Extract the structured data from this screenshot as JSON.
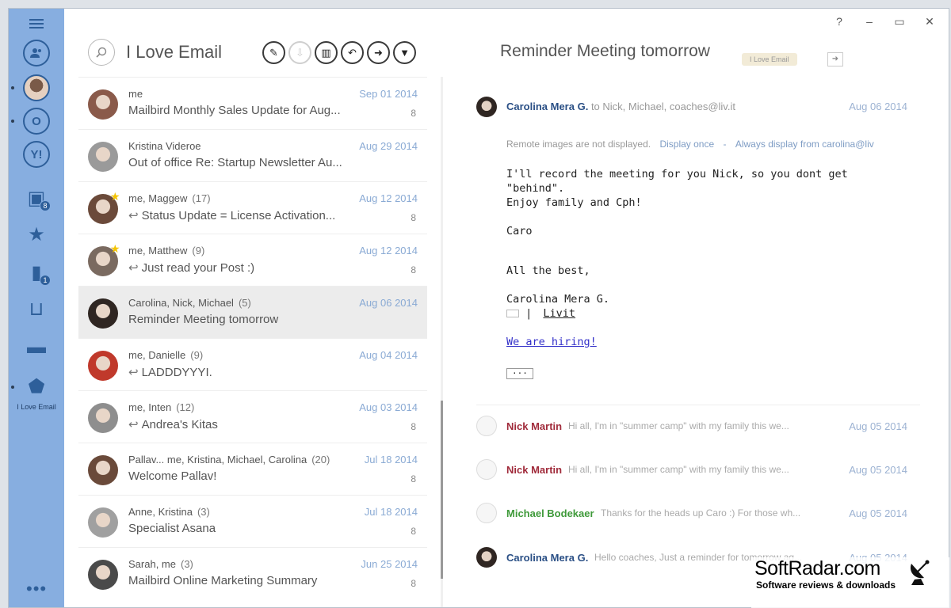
{
  "window": {
    "help": "?",
    "minimize": "–",
    "maximize": "▭",
    "close": "✕"
  },
  "sidebar": {
    "account_label": "I Love Email",
    "more": "•••"
  },
  "list": {
    "title": "I Love Email",
    "messages": [
      {
        "from": "me",
        "count": "",
        "date": "Sep 01 2014",
        "subject": "Mailbird Monthly Sales Update for Aug...",
        "num": "8",
        "reply": false,
        "star": false,
        "avatar_color": "#8a5a4a"
      },
      {
        "from": "Kristina Videroe",
        "count": "",
        "date": "Aug 29 2014",
        "subject": "Out of office Re: Startup Newsletter Au...",
        "num": "",
        "reply": false,
        "star": false,
        "avatar_color": "#9a9a9a"
      },
      {
        "from": "me, Maggew",
        "count": "(17)",
        "date": "Aug 12 2014",
        "subject": "Status Update = License Activation...",
        "num": "8",
        "reply": true,
        "star": true,
        "avatar_color": "#6b4a3a"
      },
      {
        "from": "me, Matthew",
        "count": "(9)",
        "date": "Aug 12 2014",
        "subject": "Just read your Post :)",
        "num": "8",
        "reply": true,
        "star": true,
        "avatar_color": "#7a6a60"
      },
      {
        "from": "Carolina, Nick, Michael",
        "count": "(5)",
        "date": "Aug 06 2014",
        "subject": "Reminder Meeting tomorrow",
        "num": "",
        "reply": false,
        "star": false,
        "avatar_color": "#2f2622",
        "selected": true
      },
      {
        "from": "me, Danielle",
        "count": "(9)",
        "date": "Aug 04 2014",
        "subject": "LADDDYYYI.",
        "num": "",
        "reply": true,
        "star": false,
        "avatar_color": "#c0392b"
      },
      {
        "from": "me, Inten",
        "count": "(12)",
        "date": "Aug 03 2014",
        "subject": "Andrea's Kitas",
        "num": "8",
        "reply": true,
        "star": false,
        "avatar_color": "#8e8e8e"
      },
      {
        "from": "Pallav... me, Kristina, Michael, Carolina",
        "count": "(20)",
        "date": "Jul 18 2014",
        "subject": "Welcome Pallav!",
        "num": "8",
        "reply": false,
        "star": false,
        "avatar_color": "#6a4a3a"
      },
      {
        "from": "Anne, Kristina",
        "count": "(3)",
        "date": "Jul 18 2014",
        "subject": "Specialist Asana",
        "num": "8",
        "reply": false,
        "star": false,
        "avatar_color": "#a0a0a0"
      },
      {
        "from": "Sarah, me",
        "count": "(3)",
        "date": "Jun 25 2014",
        "subject": "Mailbird Online Marketing Summary",
        "num": "8",
        "reply": false,
        "star": false,
        "avatar_color": "#4a4a4a"
      }
    ]
  },
  "reading": {
    "title": "Reminder Meeting tomorrow",
    "folder_tag": "I Love Email",
    "sender": "Carolina Mera G.",
    "to": "to Nick, Michael, coaches@liv.it",
    "date": "Aug 06 2014",
    "remote_notice": "Remote images are not displayed.",
    "display_once": "Display once",
    "separator": "-",
    "always_display": "Always display from carolina@liv",
    "body_line1": "I'll record the meeting for you Nick, so you dont get \"behind\".",
    "body_line2": "Enjoy family and Cph!",
    "signoff_name": "Caro",
    "all_the_best": "All the best,",
    "sig_name": "Carolina Mera G.",
    "sig_pipe": "|",
    "sig_company": "Livit",
    "hiring_link": "We are hiring!",
    "ellipsis": "···",
    "thread": [
      {
        "name": "Nick Martin",
        "preview": "Hi all, I'm in \"summer camp\" with my family this we...",
        "date": "Aug 05 2014",
        "color": "#a02a3a",
        "avatar": "empty"
      },
      {
        "name": "Nick Martin",
        "preview": "Hi all, I'm in \"summer camp\" with my family this we...",
        "date": "Aug 05 2014",
        "color": "#a02a3a",
        "avatar": "empty"
      },
      {
        "name": "Michael Bodekaer",
        "preview": "Thanks for the heads up Caro :) For those wh...",
        "date": "Aug 05 2014",
        "color": "#3f9a3a",
        "avatar": "empty"
      },
      {
        "name": "Carolina Mera G.",
        "preview": "Hello coaches, Just a reminder for tomorrow ag...",
        "date": "Aug 05 2014",
        "color": "#2a4f85",
        "avatar": "photo"
      }
    ]
  },
  "watermark": {
    "main": "SoftRadar.com",
    "sub": "Software reviews & downloads"
  }
}
